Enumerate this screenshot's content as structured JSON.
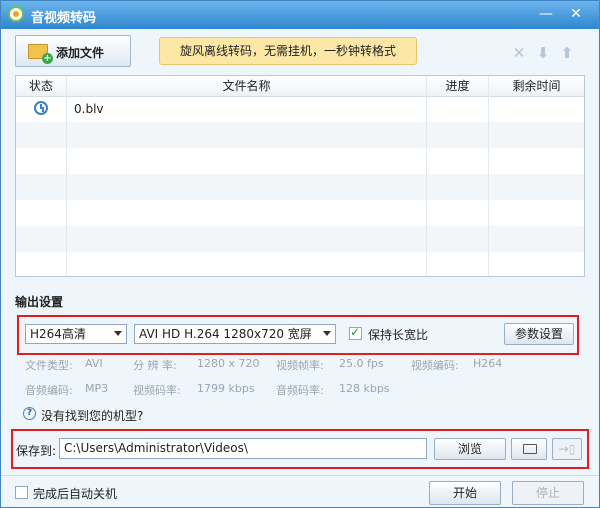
{
  "window": {
    "title": "音视频转码",
    "minimize_glyph": "—",
    "close_glyph": "✕"
  },
  "toolbar": {
    "add_file_label": "添加文件",
    "promo_text": "旋风离线转码，无需挂机，一秒钟转格式",
    "delete_glyph": "✕",
    "down_glyph": "⬇",
    "up_glyph": "⬆"
  },
  "file_table": {
    "columns": [
      "状态",
      "文件名称",
      "进度",
      "剩余时间"
    ],
    "rows": [
      {
        "status_icon": "clock-icon",
        "name": "0.blv",
        "progress": "",
        "remaining": ""
      }
    ]
  },
  "output": {
    "section_title": "输出设置",
    "quality_value": "H264高清",
    "format_value": "AVI HD H.264 1280x720 宽屏",
    "keep_ratio_label": "保持长宽比",
    "keep_ratio_checked": true,
    "params_button": "参数设置",
    "info": {
      "file_type_label": "文件类型:",
      "file_type_value": "AVI",
      "resolution_label": "分 辨 率:",
      "resolution_value": "1280 x 720",
      "framerate_label": "视频帧率:",
      "framerate_value": "25.0 fps",
      "video_codec_label": "视频编码:",
      "video_codec_value": "H264",
      "audio_codec_label": "音频编码:",
      "audio_codec_value": "MP3",
      "video_bitrate_label": "视频码率:",
      "video_bitrate_value": "1799 kbps",
      "audio_bitrate_label": "音频码率:",
      "audio_bitrate_value": "128 kbps"
    },
    "help_glyph": "?",
    "help_link": "没有找到您的机型?"
  },
  "save": {
    "label": "保存到:",
    "path": "C:\\Users\\Administrator\\Videos\\",
    "browse_button": "浏览",
    "device_glyph": "→▯"
  },
  "footer": {
    "auto_shutdown_label": "完成后自动关机",
    "auto_shutdown_checked": false,
    "start_button": "开始",
    "stop_button": "停止"
  },
  "colors": {
    "titlebar": "#2f86cf",
    "promo_bg": "#fde7a6",
    "highlight_box": "#e02020"
  }
}
